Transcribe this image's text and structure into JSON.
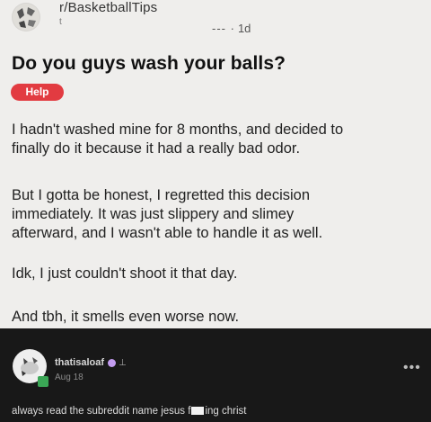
{
  "post": {
    "subreddit": "r/BasketballTips",
    "author_fragment": "t",
    "time": "1d",
    "title": "Do you guys wash your balls?",
    "flair": "Help",
    "paragraphs": [
      "I hadn't washed mine for 8 months, and decided to\nfinally do it because it had a really bad odor.",
      "But I gotta be honest, I regretted this decision\nimmediately. It was just slippery and slimey\nafterward, and I wasn't able to handle it as well.",
      "Idk, I just couldn't shoot it that day.",
      "And tbh, it smells even worse now."
    ]
  },
  "comment": {
    "username": "thatisaloaf",
    "date": "Aug 18",
    "text_before": "always read the subreddit name jesus f",
    "text_after": "ing christ",
    "more_label": "•••"
  },
  "colors": {
    "flair": "#e23b41",
    "dark_bg": "#181818",
    "badge": "#c39cf0",
    "avatar_badge": "#3aa655"
  }
}
